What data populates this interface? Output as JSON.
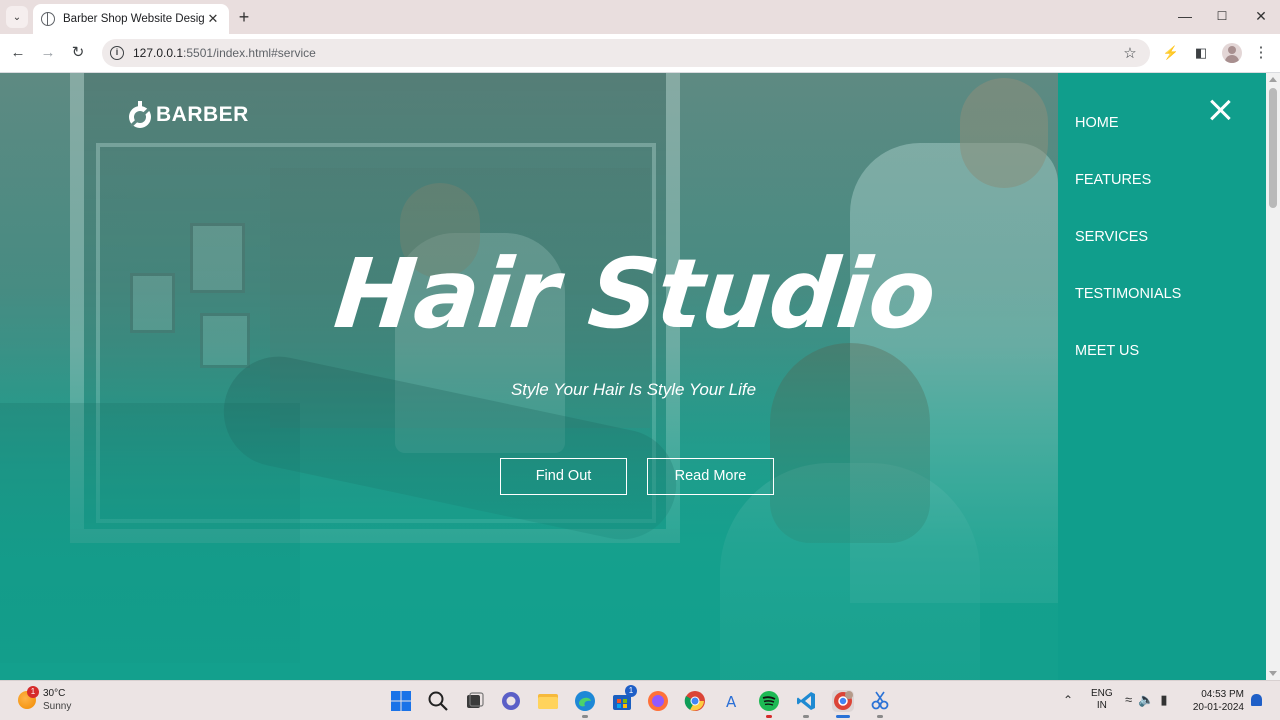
{
  "browser": {
    "tab_title": "Barber Shop Website Design",
    "url": "127.0.0.1:5501/index.html#service",
    "url_host": "127.0.0.1",
    "url_rest": ":5501/index.html#service"
  },
  "site": {
    "logo_text": "BARBER",
    "hero_title": "Hair Studio",
    "hero_subtitle": "Style Your Hair Is Style Your Life",
    "buttons": {
      "find_out": "Find Out",
      "read_more": "Read More"
    },
    "nav_items": [
      "HOME",
      "FEATURES",
      "SERVICES",
      "TESTIMONIALS",
      "MEET US"
    ],
    "accent_color": "#109e8c"
  },
  "taskbar": {
    "weather_temp": "30°C",
    "weather_condition": "Sunny",
    "weather_badge": "1",
    "store_badge": "1",
    "language": "ENG",
    "region": "IN",
    "time": "04:53 PM",
    "date": "20-01-2024",
    "apps": [
      "windows-start",
      "search",
      "task-view",
      "chat",
      "file-explorer",
      "edge",
      "microsoft-store",
      "firefox",
      "chrome",
      "font-app",
      "spotify",
      "vscode",
      "chrome-profile",
      "snipping-tool"
    ]
  }
}
